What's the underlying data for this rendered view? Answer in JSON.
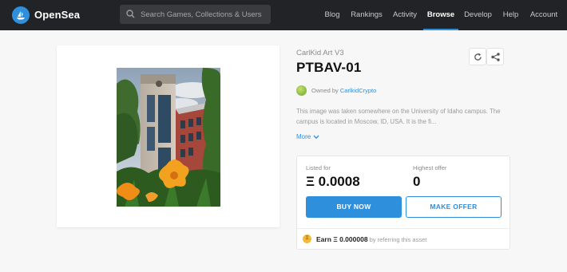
{
  "nav": {
    "brand": "OpenSea",
    "search_placeholder": "Search Games, Collections & Users",
    "links": [
      "Blog",
      "Rankings",
      "Activity",
      "Browse",
      "Develop",
      "Help",
      "Account"
    ],
    "active_link": "Browse"
  },
  "asset": {
    "collection": "CarlKid Art V3",
    "title": "PTBAV-01",
    "owned_by_label": "Owned by",
    "owner_name": "CarlkidCrypto",
    "description": "This image was taken somewhere on the University of Idaho campus. The campus is located in Moscow, ID, USA. It is the fi...",
    "more_label": "More"
  },
  "listing": {
    "listed_for_label": "Listed for",
    "listed_price": "Ξ 0.0008",
    "highest_offer_label": "Highest offer",
    "highest_offer": "0",
    "buy_button": "BUY NOW",
    "offer_button": "MAKE OFFER",
    "earn_prefix": "Earn Ξ 0.000008",
    "earn_suffix": " by referring this asset",
    "coin_glyph": "Ξ"
  },
  "colors": {
    "nav_bg": "#222326",
    "accent": "#2e8fdd",
    "page_bg": "#f7f7f7"
  },
  "icons": [
    "opensea-logo-icon",
    "search-icon",
    "refresh-icon",
    "share-icon",
    "chevron-down-icon",
    "coin-icon"
  ]
}
